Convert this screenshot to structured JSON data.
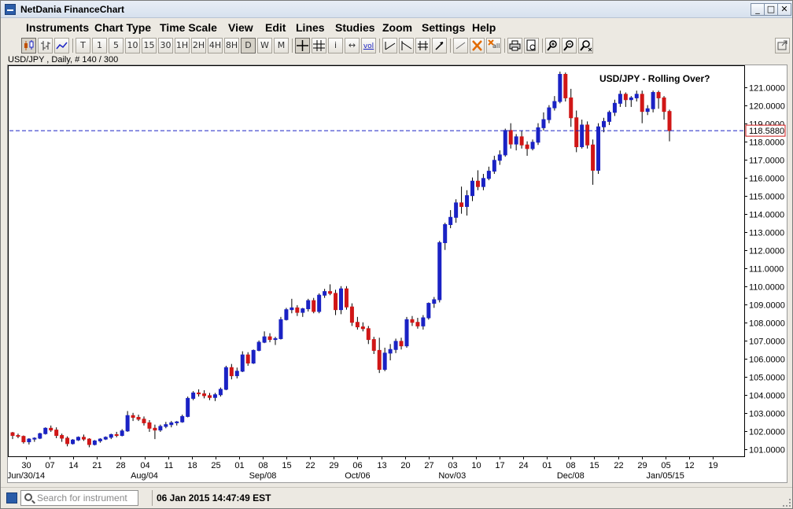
{
  "window": {
    "title": "NetDania FinanceChart",
    "controls": [
      "_",
      "□",
      "✕"
    ]
  },
  "menubar": [
    "Instruments",
    "Chart Type",
    "Time Scale",
    "View",
    "Edit",
    "Lines",
    "Studies",
    "Zoom",
    "Settings",
    "Help"
  ],
  "toolbar": {
    "chart_type_buttons": [
      "candlestick-icon",
      "ohlc-bars-icon",
      "line-chart-icon"
    ],
    "time_scale_buttons": [
      "T",
      "1",
      "5",
      "10",
      "15",
      "30",
      "1H",
      "2H",
      "4H",
      "8H",
      "D",
      "W",
      "M"
    ],
    "active_time_scale": "D",
    "tool_buttons": [
      "crosshair-icon",
      "grid-icon",
      "info-icon",
      "zoom-arrows-icon",
      "volume-icon",
      "trend-line-icon",
      "trend-channel-icon",
      "fibonacci-icon",
      "cursor-icon",
      "line-icon",
      "delete-icon",
      "delete-all-icon",
      "print-icon",
      "preview-icon",
      "zoom-in-icon",
      "zoom-out-icon",
      "zoom-reset-icon"
    ],
    "volume_label": "vol",
    "delete_all_label": "all",
    "detach_icon": "detach-icon"
  },
  "instrument_label": "USD/JPY , Daily, # 140 / 300",
  "status": {
    "search_placeholder": "Search for instrument",
    "datetime": "06 Jan 2015 14:47:49 EST"
  },
  "colors": {
    "up_candle": "#1a22c4",
    "down_candle": "#d01717",
    "price_line": "#1a22c4",
    "price_label_border": "#d01717"
  },
  "chart_data": {
    "type": "candlestick",
    "title": "USD/JPY - Rolling Over?",
    "ylim": [
      100.6,
      122.2
    ],
    "y_ticks": [
      "101.0000",
      "102.0000",
      "103.0000",
      "104.0000",
      "105.0000",
      "106.0000",
      "107.0000",
      "108.0000",
      "109.0000",
      "110.0000",
      "111.0000",
      "112.0000",
      "113.0000",
      "114.0000",
      "115.0000",
      "116.0000",
      "117.0000",
      "118.0000",
      "119.0000",
      "120.0000",
      "121.0000"
    ],
    "y_tick_values": [
      101,
      102,
      103,
      104,
      105,
      106,
      107,
      108,
      109,
      110,
      111,
      112,
      113,
      114,
      115,
      116,
      117,
      118,
      119,
      120,
      121
    ],
    "last_price": 118.588,
    "last_price_label": "118.5880",
    "x_ticks": [
      "30",
      "07",
      "14",
      "21",
      "28",
      "04",
      "11",
      "18",
      "25",
      "01",
      "08",
      "15",
      "22",
      "29",
      "06",
      "13",
      "20",
      "27",
      "03",
      "10",
      "17",
      "24",
      "01",
      "08",
      "15",
      "22",
      "29",
      "05",
      "12",
      "19"
    ],
    "month_labels": [
      {
        "label": "Jun/30/14",
        "tick": 0
      },
      {
        "label": "Aug/04",
        "tick": 5
      },
      {
        "label": "Sep/08",
        "tick": 10
      },
      {
        "label": "Oct/06",
        "tick": 14
      },
      {
        "label": "Nov/03",
        "tick": 18
      },
      {
        "label": "Dec/08",
        "tick": 23
      },
      {
        "label": "Jan/05/15",
        "tick": 27
      }
    ],
    "candles": [
      [
        101.9,
        101.95,
        101.55,
        101.75
      ],
      [
        101.75,
        101.85,
        101.6,
        101.7
      ],
      [
        101.7,
        101.75,
        101.3,
        101.4
      ],
      [
        101.4,
        101.6,
        101.25,
        101.55
      ],
      [
        101.55,
        101.65,
        101.4,
        101.6
      ],
      [
        101.6,
        101.9,
        101.55,
        101.85
      ],
      [
        101.85,
        102.2,
        101.8,
        102.15
      ],
      [
        102.15,
        102.3,
        101.95,
        102.05
      ],
      [
        102.05,
        102.2,
        101.6,
        101.75
      ],
      [
        101.75,
        101.85,
        101.4,
        101.6
      ],
      [
        101.6,
        101.7,
        101.15,
        101.3
      ],
      [
        101.3,
        101.55,
        101.25,
        101.5
      ],
      [
        101.5,
        101.7,
        101.45,
        101.65
      ],
      [
        101.65,
        101.8,
        101.45,
        101.55
      ],
      [
        101.55,
        101.6,
        101.1,
        101.25
      ],
      [
        101.25,
        101.5,
        101.2,
        101.45
      ],
      [
        101.45,
        101.6,
        101.35,
        101.55
      ],
      [
        101.55,
        101.7,
        101.5,
        101.65
      ],
      [
        101.65,
        101.85,
        101.55,
        101.8
      ],
      [
        101.8,
        101.95,
        101.65,
        101.75
      ],
      [
        101.75,
        102.1,
        101.7,
        102.0
      ],
      [
        102.0,
        103.1,
        101.95,
        102.85
      ],
      [
        102.85,
        103.0,
        102.55,
        102.75
      ],
      [
        102.75,
        102.9,
        102.55,
        102.65
      ],
      [
        102.65,
        102.8,
        102.3,
        102.45
      ],
      [
        102.45,
        102.6,
        101.95,
        102.15
      ],
      [
        102.15,
        102.35,
        101.55,
        102.05
      ],
      [
        102.05,
        102.35,
        101.95,
        102.25
      ],
      [
        102.25,
        102.5,
        102.15,
        102.35
      ],
      [
        102.35,
        102.55,
        102.2,
        102.45
      ],
      [
        102.45,
        102.55,
        102.3,
        102.5
      ],
      [
        102.5,
        102.9,
        102.45,
        102.8
      ],
      [
        102.8,
        103.9,
        102.75,
        103.8
      ],
      [
        103.8,
        104.2,
        103.7,
        104.1
      ],
      [
        104.1,
        104.3,
        103.9,
        104.05
      ],
      [
        104.05,
        104.25,
        103.8,
        103.95
      ],
      [
        103.95,
        104.1,
        103.7,
        103.85
      ],
      [
        103.85,
        104.1,
        103.65,
        104.0
      ],
      [
        104.0,
        104.4,
        103.9,
        104.3
      ],
      [
        104.3,
        105.6,
        104.25,
        105.5
      ],
      [
        105.5,
        105.7,
        104.85,
        105.05
      ],
      [
        105.05,
        105.5,
        104.9,
        105.3
      ],
      [
        105.3,
        106.4,
        105.25,
        106.2
      ],
      [
        106.2,
        106.35,
        105.6,
        105.75
      ],
      [
        105.75,
        106.5,
        105.7,
        106.45
      ],
      [
        106.45,
        107.0,
        106.4,
        106.9
      ],
      [
        106.9,
        107.5,
        106.85,
        107.2
      ],
      [
        107.2,
        107.4,
        106.9,
        107.05
      ],
      [
        107.05,
        107.2,
        106.75,
        107.1
      ],
      [
        107.1,
        108.3,
        107.05,
        108.15
      ],
      [
        108.15,
        108.8,
        108.1,
        108.7
      ],
      [
        108.7,
        109.3,
        108.5,
        108.8
      ],
      [
        108.8,
        108.95,
        108.35,
        108.55
      ],
      [
        108.55,
        108.8,
        108.3,
        108.75
      ],
      [
        108.75,
        109.3,
        108.6,
        109.2
      ],
      [
        109.2,
        109.35,
        108.5,
        108.6
      ],
      [
        108.6,
        109.6,
        108.5,
        109.5
      ],
      [
        109.5,
        109.85,
        109.35,
        109.7
      ],
      [
        109.7,
        110.1,
        109.5,
        109.6
      ],
      [
        109.6,
        109.8,
        108.4,
        108.7
      ],
      [
        108.7,
        110.0,
        108.45,
        109.85
      ],
      [
        109.85,
        110.0,
        108.7,
        108.85
      ],
      [
        108.85,
        109.05,
        107.8,
        108.0
      ],
      [
        108.0,
        108.3,
        107.6,
        107.75
      ],
      [
        107.75,
        108.0,
        107.5,
        107.65
      ],
      [
        107.65,
        107.8,
        106.8,
        107.05
      ],
      [
        107.05,
        107.2,
        106.25,
        106.45
      ],
      [
        106.45,
        107.15,
        105.2,
        105.4
      ],
      [
        105.4,
        106.6,
        105.3,
        106.3
      ],
      [
        106.3,
        106.8,
        105.9,
        106.5
      ],
      [
        106.5,
        107.1,
        106.3,
        106.95
      ],
      [
        106.95,
        107.15,
        106.5,
        106.7
      ],
      [
        106.7,
        108.3,
        106.6,
        108.15
      ],
      [
        108.15,
        108.35,
        107.8,
        108.0
      ],
      [
        108.0,
        108.25,
        107.65,
        107.8
      ],
      [
        107.8,
        108.4,
        107.6,
        108.25
      ],
      [
        108.25,
        109.1,
        108.15,
        109.05
      ],
      [
        109.05,
        109.4,
        108.8,
        109.25
      ],
      [
        109.25,
        112.5,
        109.1,
        112.4
      ],
      [
        112.4,
        113.5,
        112.0,
        113.4
      ],
      [
        113.4,
        114.2,
        113.2,
        113.8
      ],
      [
        113.8,
        114.8,
        113.5,
        114.6
      ],
      [
        114.6,
        115.5,
        114.0,
        114.4
      ],
      [
        114.4,
        115.3,
        113.9,
        115.0
      ],
      [
        115.0,
        116.0,
        114.7,
        115.8
      ],
      [
        115.8,
        116.4,
        115.3,
        115.5
      ],
      [
        115.5,
        116.2,
        115.3,
        115.95
      ],
      [
        115.95,
        116.6,
        115.85,
        116.35
      ],
      [
        116.35,
        117.2,
        116.2,
        116.95
      ],
      [
        116.95,
        117.5,
        116.7,
        117.25
      ],
      [
        117.25,
        118.7,
        117.15,
        118.6
      ],
      [
        118.6,
        119.0,
        117.6,
        117.85
      ],
      [
        117.85,
        118.4,
        117.5,
        118.25
      ],
      [
        118.25,
        118.6,
        117.6,
        117.8
      ],
      [
        117.8,
        118.0,
        117.2,
        117.6
      ],
      [
        117.6,
        118.1,
        117.5,
        117.95
      ],
      [
        117.95,
        119.0,
        117.8,
        118.75
      ],
      [
        118.75,
        119.6,
        118.6,
        119.2
      ],
      [
        119.2,
        120.0,
        119.0,
        119.85
      ],
      [
        119.85,
        120.5,
        119.7,
        120.2
      ],
      [
        120.2,
        121.85,
        120.1,
        121.7
      ],
      [
        121.7,
        121.8,
        120.2,
        120.4
      ],
      [
        120.4,
        120.9,
        118.8,
        119.3
      ],
      [
        119.3,
        119.7,
        117.4,
        117.7
      ],
      [
        117.7,
        119.2,
        117.6,
        118.9
      ],
      [
        118.9,
        119.1,
        117.6,
        117.8
      ],
      [
        117.8,
        118.1,
        115.6,
        116.4
      ],
      [
        116.4,
        119.0,
        116.2,
        118.8
      ],
      [
        118.8,
        119.3,
        118.5,
        119.1
      ],
      [
        119.1,
        119.7,
        118.9,
        119.6
      ],
      [
        119.6,
        120.3,
        119.4,
        120.1
      ],
      [
        120.1,
        120.8,
        119.9,
        120.6
      ],
      [
        120.6,
        120.7,
        119.9,
        120.3
      ],
      [
        120.3,
        120.5,
        119.9,
        120.4
      ],
      [
        120.4,
        120.8,
        120.2,
        120.6
      ],
      [
        120.6,
        120.8,
        119.0,
        119.65
      ],
      [
        119.65,
        120.0,
        119.45,
        119.8
      ],
      [
        119.8,
        120.8,
        119.6,
        120.7
      ],
      [
        120.7,
        120.8,
        119.8,
        120.4
      ],
      [
        120.4,
        120.5,
        119.2,
        119.65
      ],
      [
        119.65,
        119.75,
        118.0,
        118.59
      ]
    ]
  }
}
